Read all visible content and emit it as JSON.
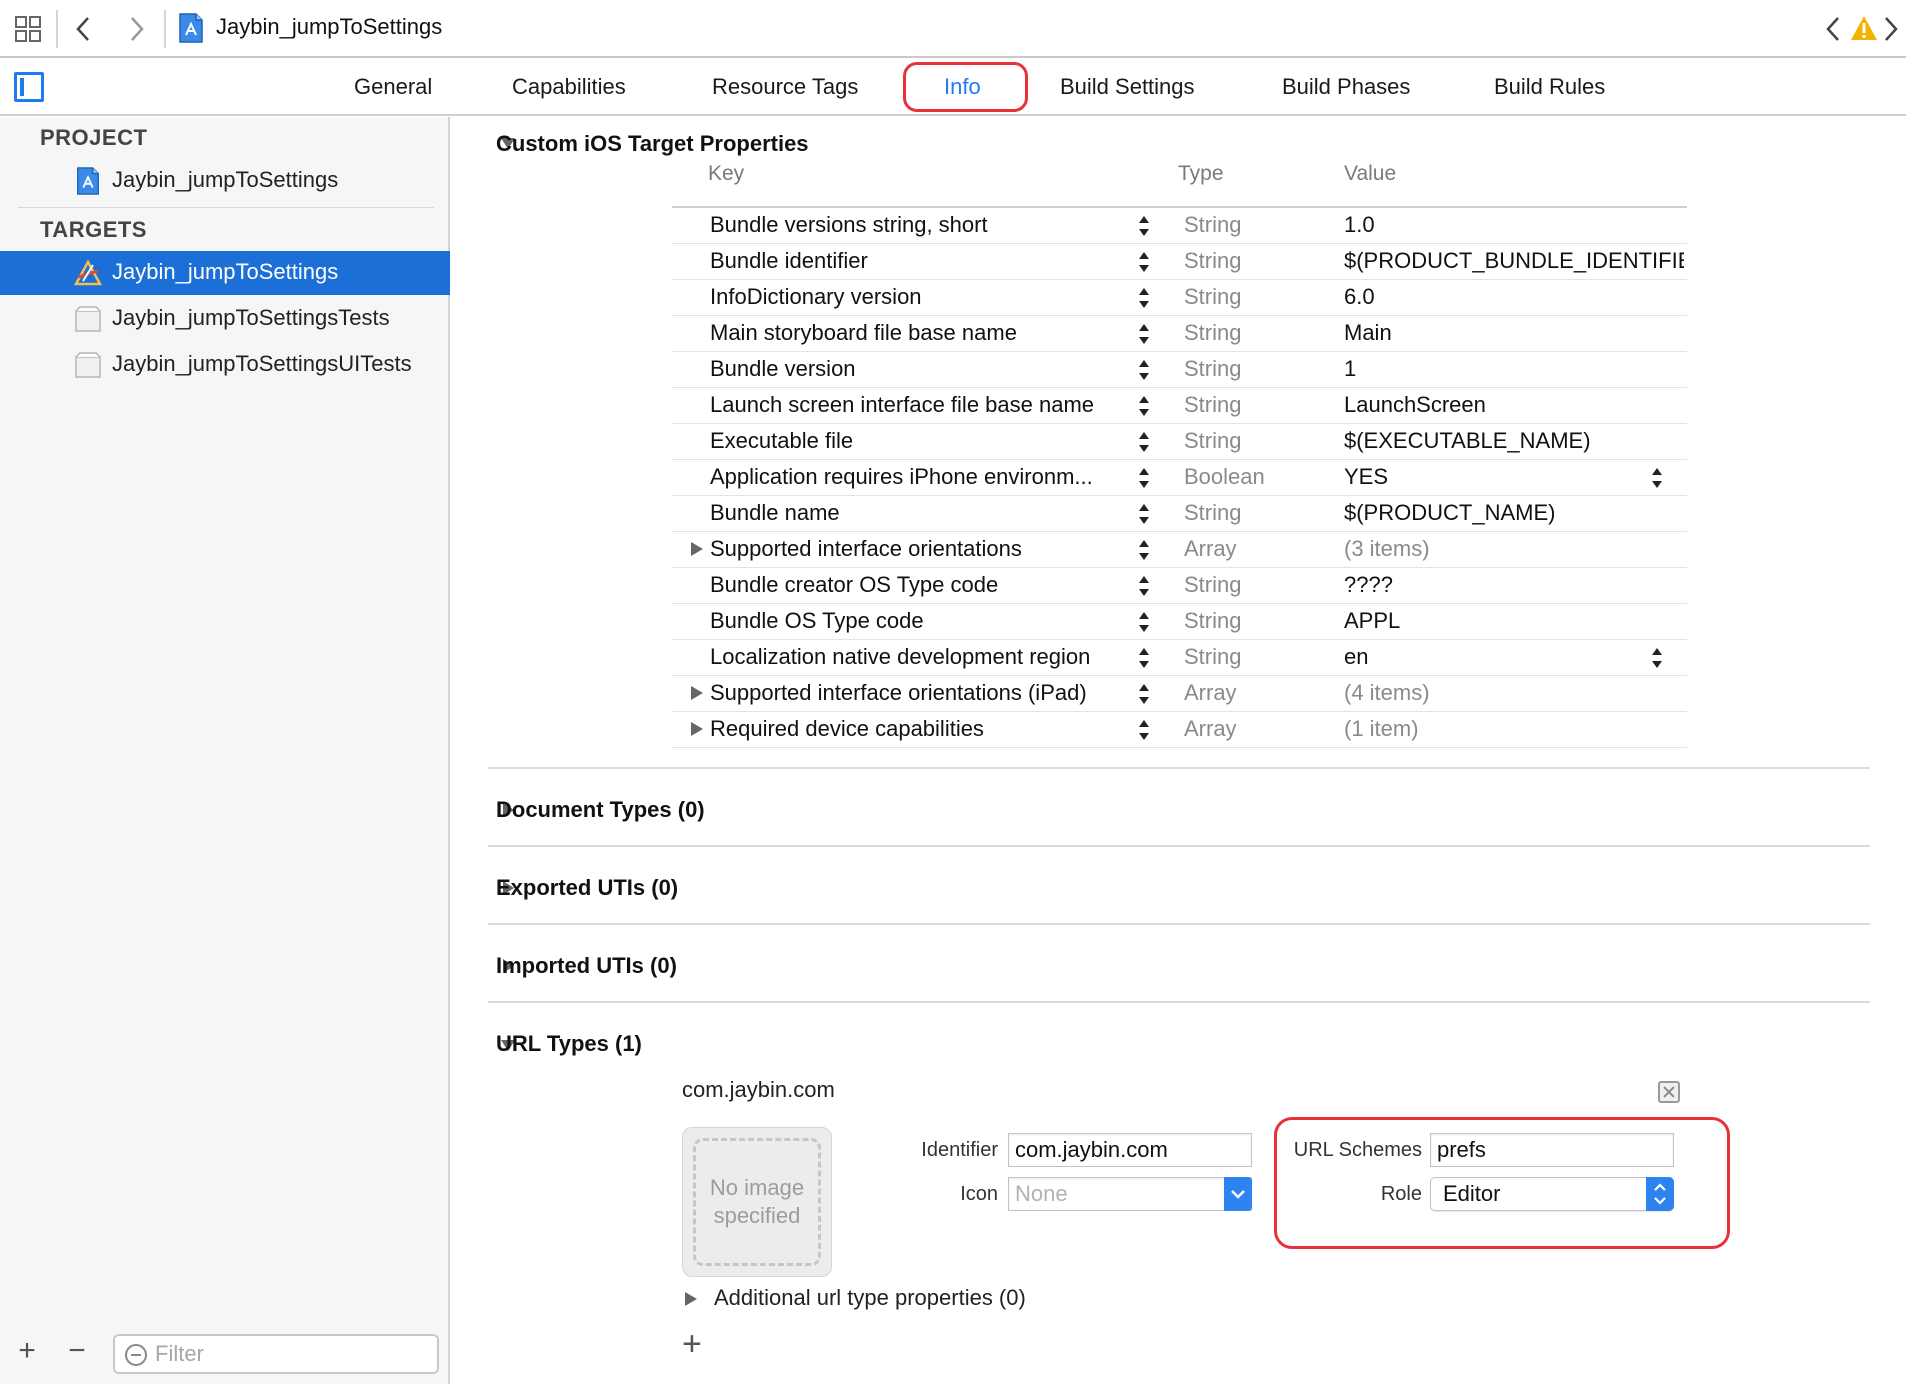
{
  "pathbar": {
    "file_name": "Jaybin_jumpToSettings"
  },
  "tabs": [
    {
      "label": "General"
    },
    {
      "label": "Capabilities"
    },
    {
      "label": "Resource Tags"
    },
    {
      "label": "Info",
      "active": true
    },
    {
      "label": "Build Settings"
    },
    {
      "label": "Build Phases"
    },
    {
      "label": "Build Rules"
    }
  ],
  "sidebar": {
    "project_heading": "PROJECT",
    "project_item": "Jaybin_jumpToSettings",
    "targets_heading": "TARGETS",
    "targets": [
      {
        "label": "Jaybin_jumpToSettings",
        "selected": true,
        "icon": "app-target-icon"
      },
      {
        "label": "Jaybin_jumpToSettingsTests",
        "selected": false,
        "icon": "test-bundle-icon"
      },
      {
        "label": "Jaybin_jumpToSettingsUITests",
        "selected": false,
        "icon": "test-bundle-icon"
      }
    ],
    "filter_placeholder": "Filter",
    "plus_label": "+",
    "minus_label": "−"
  },
  "sections": {
    "custom_props_title": "Custom iOS Target Properties",
    "document_types": "Document Types (0)",
    "exported_utis": "Exported UTIs (0)",
    "imported_utis": "Imported UTIs (0)",
    "url_types": "URL Types (1)"
  },
  "prop_table": {
    "headers": {
      "key": "Key",
      "type": "Type",
      "value": "Value"
    },
    "rows": [
      {
        "key": "Bundle versions string, short",
        "type": "String",
        "value": "1.0"
      },
      {
        "key": "Bundle identifier",
        "type": "String",
        "value": "$(PRODUCT_BUNDLE_IDENTIFIE"
      },
      {
        "key": "InfoDictionary version",
        "type": "String",
        "value": "6.0"
      },
      {
        "key": "Main storyboard file base name",
        "type": "String",
        "value": "Main"
      },
      {
        "key": "Bundle version",
        "type": "String",
        "value": "1"
      },
      {
        "key": "Launch screen interface file base name",
        "type": "String",
        "value": "LaunchScreen"
      },
      {
        "key": "Executable file",
        "type": "String",
        "value": "$(EXECUTABLE_NAME)"
      },
      {
        "key": "Application requires iPhone environm...",
        "type": "Boolean",
        "value": "YES",
        "value_stepper": true
      },
      {
        "key": "Bundle name",
        "type": "String",
        "value": "$(PRODUCT_NAME)"
      },
      {
        "key": "Supported interface orientations",
        "type": "Array",
        "value": "(3 items)",
        "expandable": true,
        "muted": true
      },
      {
        "key": "Bundle creator OS Type code",
        "type": "String",
        "value": "????"
      },
      {
        "key": "Bundle OS Type code",
        "type": "String",
        "value": "APPL"
      },
      {
        "key": "Localization native development region",
        "type": "String",
        "value": "en",
        "value_stepper": true
      },
      {
        "key": "Supported interface orientations (iPad)",
        "type": "Array",
        "value": "(4 items)",
        "expandable": true,
        "muted": true
      },
      {
        "key": "Required device capabilities",
        "type": "Array",
        "value": "(1 item)",
        "expandable": true,
        "muted": true
      }
    ]
  },
  "url_type": {
    "title": "com.jaybin.com",
    "no_image_text": "No image specified",
    "identifier_label": "Identifier",
    "identifier_value": "com.jaybin.com",
    "icon_label": "Icon",
    "icon_value": "None",
    "schemes_label": "URL Schemes",
    "schemes_value": "prefs",
    "role_label": "Role",
    "role_value": "Editor",
    "additional": "Additional url type properties (0)",
    "add_label": "+"
  },
  "colors": {
    "accent": "#1e7cf2",
    "selection": "#1c6fd6",
    "highlight_red": "#e8323a",
    "warning": "#f5b301"
  }
}
